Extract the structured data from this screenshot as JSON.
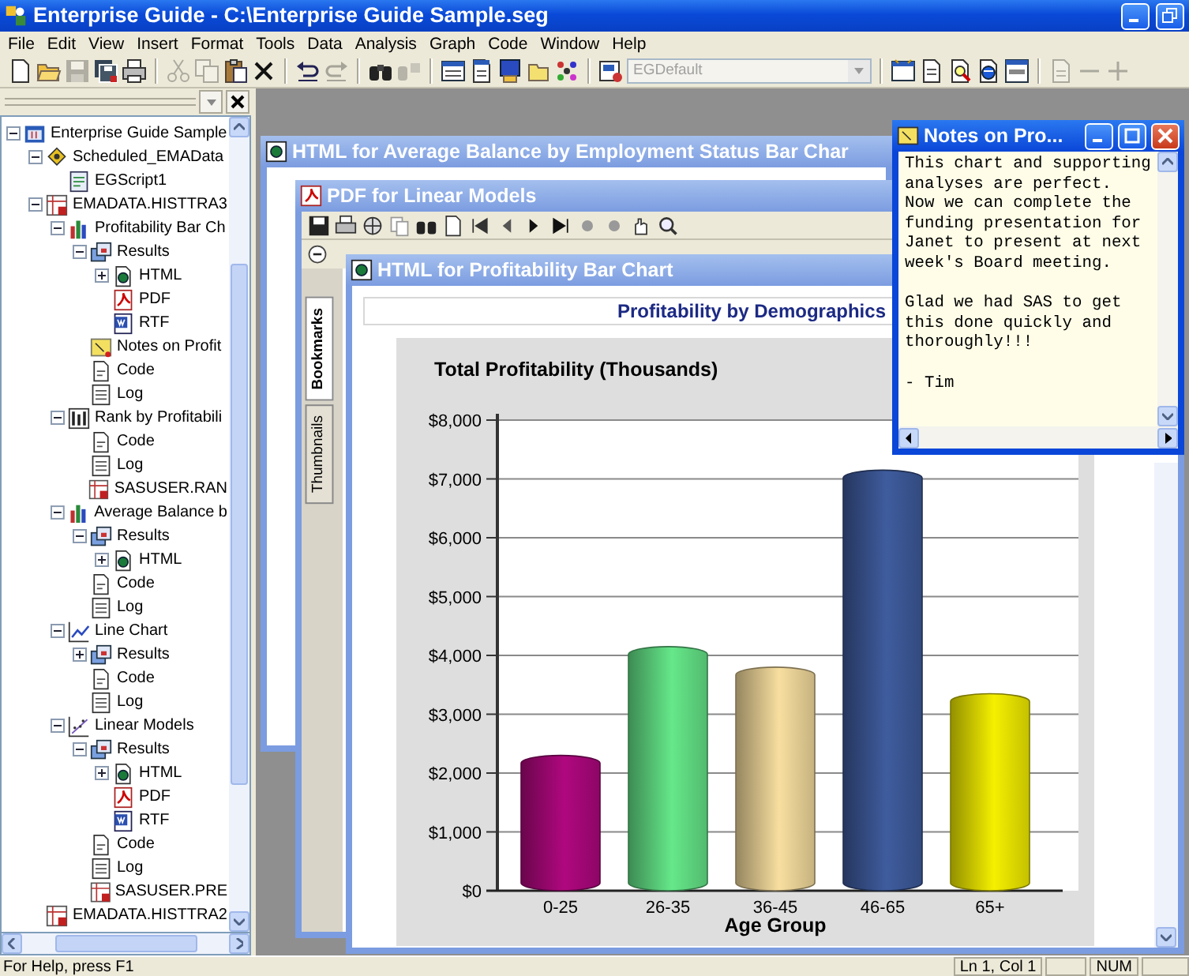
{
  "window": {
    "title": "Enterprise Guide - C:\\Enterprise Guide Sample.seg"
  },
  "menu": [
    "File",
    "Edit",
    "View",
    "Insert",
    "Format",
    "Tools",
    "Data",
    "Analysis",
    "Graph",
    "Code",
    "Window",
    "Help"
  ],
  "toolbar": [
    {
      "kind": "button",
      "disabled": false
    },
    {
      "kind": "button",
      "disabled": false
    },
    {
      "kind": "button",
      "disabled": true
    },
    {
      "kind": "button",
      "disabled": false
    },
    {
      "kind": "button",
      "disabled": false
    },
    {
      "kind": "separator"
    },
    {
      "kind": "button",
      "disabled": true
    },
    {
      "kind": "button",
      "disabled": true
    },
    {
      "kind": "button",
      "disabled": false
    },
    {
      "kind": "button",
      "disabled": false
    },
    {
      "kind": "separator"
    },
    {
      "kind": "button",
      "disabled": false
    },
    {
      "kind": "button",
      "disabled": true
    },
    {
      "kind": "separator"
    },
    {
      "kind": "button",
      "disabled": false
    },
    {
      "kind": "button",
      "disabled": true
    },
    {
      "kind": "separator"
    },
    {
      "kind": "button",
      "disabled": false
    },
    {
      "kind": "button",
      "disabled": false
    },
    {
      "kind": "button",
      "disabled": false
    },
    {
      "kind": "button",
      "disabled": false
    },
    {
      "kind": "button",
      "disabled": false
    },
    {
      "kind": "separator"
    },
    {
      "kind": "button",
      "disabled": false
    },
    {
      "kind": "combo",
      "value": "EGDefault",
      "disabled": true
    },
    {
      "kind": "separator"
    },
    {
      "kind": "button",
      "disabled": false
    },
    {
      "kind": "button",
      "disabled": false
    },
    {
      "kind": "button",
      "disabled": false
    },
    {
      "kind": "button",
      "disabled": false
    },
    {
      "kind": "button",
      "disabled": false
    },
    {
      "kind": "separator"
    },
    {
      "kind": "button",
      "disabled": true
    },
    {
      "kind": "button",
      "disabled": true
    },
    {
      "kind": "button",
      "disabled": true
    }
  ],
  "project_tree": {
    "items": [
      {
        "label": "Enterprise Guide Sample",
        "kind": "project",
        "expanded": true,
        "children": [
          {
            "label": "Scheduled_EMAData",
            "kind": "schedule",
            "expanded": true,
            "children": [
              {
                "label": "EGScript1",
                "kind": "script"
              }
            ]
          },
          {
            "label": "EMADATA.HISTTRA3",
            "kind": "dataset",
            "expanded": true,
            "children": [
              {
                "label": "Profitability Bar Ch",
                "kind": "barchart",
                "expanded": true,
                "children": [
                  {
                    "label": "Results",
                    "kind": "results",
                    "expanded": true,
                    "children": [
                      {
                        "label": "HTML",
                        "kind": "html",
                        "expanded": false
                      },
                      {
                        "label": "PDF",
                        "kind": "pdf"
                      },
                      {
                        "label": "RTF",
                        "kind": "rtf"
                      }
                    ]
                  },
                  {
                    "label": "Notes on Profit",
                    "kind": "note"
                  },
                  {
                    "label": "Code",
                    "kind": "code"
                  },
                  {
                    "label": "Log",
                    "kind": "log"
                  }
                ]
              },
              {
                "label": "Rank by Profitabili",
                "kind": "rank",
                "expanded": true,
                "children": [
                  {
                    "label": "Code",
                    "kind": "code"
                  },
                  {
                    "label": "Log",
                    "kind": "log"
                  },
                  {
                    "label": "SASUSER.RAN",
                    "kind": "dataset"
                  }
                ]
              },
              {
                "label": "Average Balance b",
                "kind": "barchart",
                "expanded": true,
                "children": [
                  {
                    "label": "Results",
                    "kind": "results",
                    "expanded": true,
                    "children": [
                      {
                        "label": "HTML",
                        "kind": "html",
                        "expanded": false
                      }
                    ]
                  },
                  {
                    "label": "Code",
                    "kind": "code"
                  },
                  {
                    "label": "Log",
                    "kind": "log"
                  }
                ]
              },
              {
                "label": "Line Chart",
                "kind": "linechart",
                "expanded": true,
                "children": [
                  {
                    "label": "Results",
                    "kind": "results",
                    "expanded": false
                  },
                  {
                    "label": "Code",
                    "kind": "code"
                  },
                  {
                    "label": "Log",
                    "kind": "log"
                  }
                ]
              },
              {
                "label": "Linear Models",
                "kind": "linear",
                "expanded": true,
                "children": [
                  {
                    "label": "Results",
                    "kind": "results",
                    "expanded": true,
                    "children": [
                      {
                        "label": "HTML",
                        "kind": "html",
                        "expanded": false
                      },
                      {
                        "label": "PDF",
                        "kind": "pdf"
                      },
                      {
                        "label": "RTF",
                        "kind": "rtf"
                      }
                    ]
                  },
                  {
                    "label": "Code",
                    "kind": "code"
                  },
                  {
                    "label": "Log",
                    "kind": "log"
                  },
                  {
                    "label": "SASUSER.PRE",
                    "kind": "dataset"
                  }
                ]
              }
            ]
          },
          {
            "label": "EMADATA.HISTTRA2",
            "kind": "dataset"
          }
        ]
      }
    ]
  },
  "mdi_windows": [
    {
      "kind": "html",
      "title": "HTML for Average Balance by Employment Status Bar Char",
      "active": false
    },
    {
      "kind": "pdf",
      "title": "PDF for Linear Models",
      "active": false,
      "side_tabs": [
        {
          "label": "Bookmarks",
          "selected": true
        },
        {
          "label": "Thumbnails",
          "selected": false
        }
      ]
    },
    {
      "kind": "html",
      "title": "HTML for Profitability Bar Chart",
      "active": false,
      "heading": "Profitability by Demographics",
      "chart_data": {
        "type": "bar",
        "title": "Total Profitability (Thousands)",
        "xlabel": "Age Group",
        "categories": [
          "0-25",
          "26-35",
          "36-45",
          "46-65",
          "65+"
        ],
        "series": [
          {
            "values": [
              2300,
              4150,
              3800,
              7150,
              3350
            ]
          }
        ],
        "colors": [
          "#b0087f",
          "#66e88a",
          "#f8dfa0",
          "#3f5c9e",
          "#f5f000"
        ],
        "ylim": [
          0,
          8000
        ],
        "grid": true,
        "yticks": [
          {
            "value": 0,
            "label": "$0"
          },
          {
            "value": 1000,
            "label": "$1,000"
          },
          {
            "value": 2000,
            "label": "$2,000"
          },
          {
            "value": 3000,
            "label": "$3,000"
          },
          {
            "value": 4000,
            "label": "$4,000"
          },
          {
            "value": 5000,
            "label": "$5,000"
          },
          {
            "value": 6000,
            "label": "$6,000"
          },
          {
            "value": 7000,
            "label": "$7,000"
          },
          {
            "value": 8000,
            "label": "$8,000"
          }
        ]
      }
    },
    {
      "kind": "note",
      "title": "Notes on Pro...",
      "active": true,
      "text": "This chart and supporting analyses are perfect.\nNow we can complete the funding presentation for Janet to present at next week's Board meeting.\n\nGlad we had SAS to get this done quickly and thoroughly!!!\n\n- Tim"
    }
  ],
  "status_bar": {
    "message": "For Help, press F1",
    "panels": [
      "Ln 1, Col 1",
      "NUM"
    ]
  }
}
